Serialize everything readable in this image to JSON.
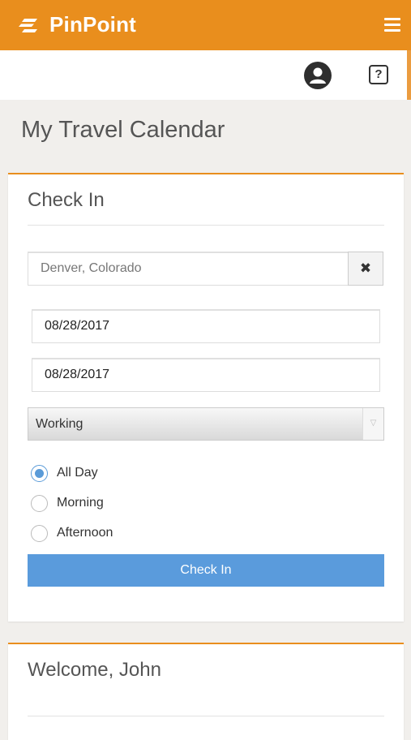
{
  "app": {
    "brand": "PinPoint",
    "icons": {
      "logo": "lines-logo-icon",
      "menu": "hamburger-menu-icon",
      "user": "user-avatar-icon",
      "help": "help-icon"
    },
    "help_glyph": "?"
  },
  "colors": {
    "brand_orange": "#e98e1d",
    "button_blue": "#5a9bdc",
    "radio_blue": "#5a9bd8"
  },
  "page": {
    "title": "My Travel Calendar"
  },
  "checkin": {
    "title": "Check In",
    "location_value": "Denver, Colorado",
    "clear_glyph": "✖",
    "start_date": "08/28/2017",
    "end_date": "08/28/2017",
    "status_selected": "Working",
    "status_arrow": "▽",
    "time_options": [
      {
        "label": "All Day",
        "checked": true
      },
      {
        "label": "Morning",
        "checked": false
      },
      {
        "label": "Afternoon",
        "checked": false
      }
    ],
    "submit_label": "Check In"
  },
  "welcome": {
    "title": "Welcome, John"
  }
}
